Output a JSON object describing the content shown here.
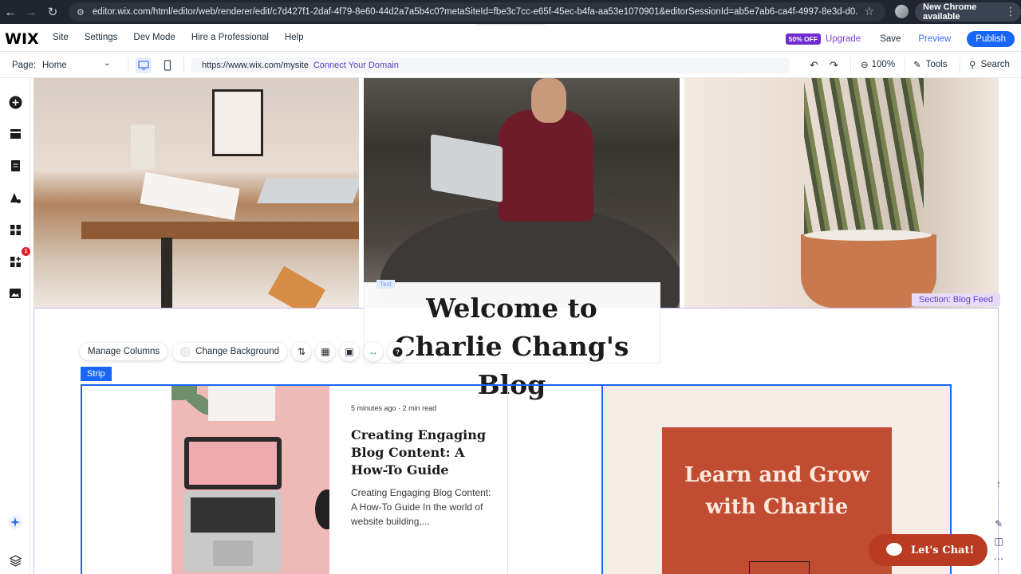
{
  "browser": {
    "url": "editor.wix.com/html/editor/web/renderer/edit/c7d427f1-2daf-4f79-8e60-44d2a7a5b4c0?metaSiteId=fbe3c7cc-e65f-45ec-b4fa-aa53e1070901&editorSessionId=ab5e7ab6-ca4f-4997-8e3d-d0...",
    "new_chrome_label": "New Chrome available"
  },
  "topbar": {
    "logo": "WIX",
    "menu": [
      "Site",
      "Settings",
      "Dev Mode",
      "Hire a Professional",
      "Help"
    ],
    "badge": "50% OFF",
    "upgrade": "Upgrade",
    "save": "Save",
    "preview": "Preview",
    "publish": "Publish"
  },
  "pagebar": {
    "page_label": "Page:",
    "page_value": "Home",
    "site_url": "https://www.wix.com/mysite",
    "connect_domain": "Connect Your Domain",
    "zoom": "100%",
    "tools": "Tools",
    "search": "Search"
  },
  "leftbar": {
    "notification_count": "1"
  },
  "canvas": {
    "section_label": "Section: Blog Feed",
    "text_label": "Text",
    "hero_title": "Welcome to Charlie Chang's Blog",
    "toolbar": {
      "manage_columns": "Manage Columns",
      "change_background": "Change Background"
    },
    "strip_label": "Strip",
    "post": {
      "time": "5 minutes ago",
      "read": "2 min read",
      "title": "Creating Engaging Blog Content: A How-To Guide",
      "excerpt": "Creating Engaging Blog Content: A How-To Guide In the world of website building,..."
    },
    "promo_title": "Learn and Grow with Charlie",
    "chat_label": "Let's Chat!"
  },
  "colors": {
    "accent": "#1866f5",
    "upgrade": "#7d3ed9",
    "promo": "#c04d32",
    "section": "#c7b6f2"
  }
}
